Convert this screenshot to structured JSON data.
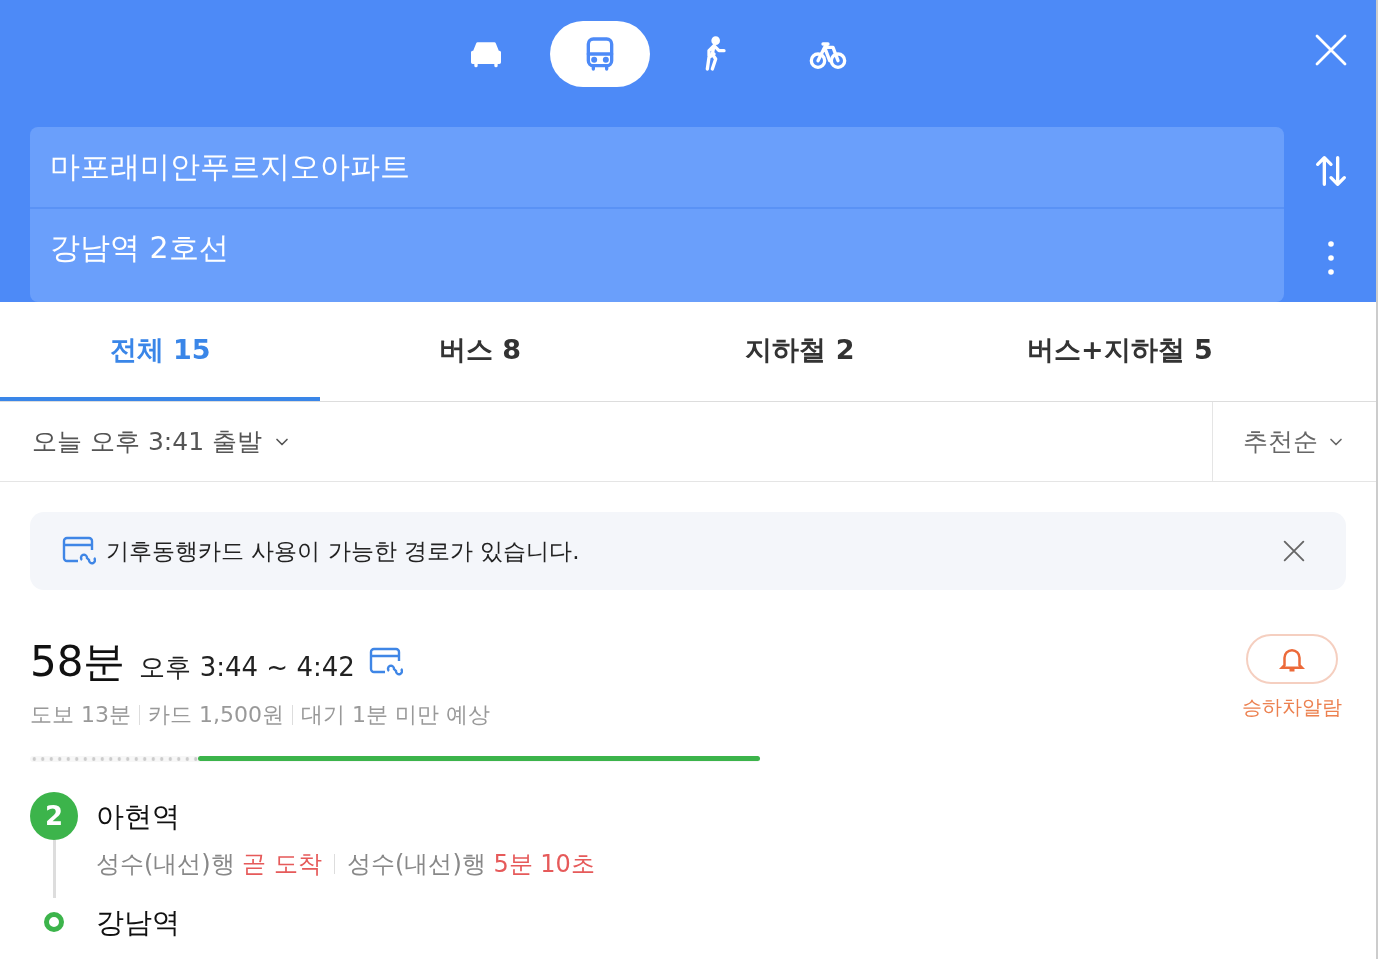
{
  "modes": [
    {
      "kind": "car",
      "selected": false
    },
    {
      "kind": "bus",
      "selected": true
    },
    {
      "kind": "walk",
      "selected": false
    },
    {
      "kind": "bike",
      "selected": false
    }
  ],
  "origin": {
    "value": "마포래미안푸르지오아파트"
  },
  "destination": {
    "value": "강남역 2호선"
  },
  "tabs": [
    {
      "label": "전체 15",
      "selected": true
    },
    {
      "label": "버스 8",
      "selected": false
    },
    {
      "label": "지하철 2",
      "selected": false
    },
    {
      "label": "버스+지하철 5",
      "selected": false
    }
  ],
  "departure": "오늘 오후 3:41 출발",
  "sort": "추천순",
  "banner": {
    "text": "기후동행카드 사용이 가능한 경로가 있습니다."
  },
  "route": {
    "duration": "58분",
    "time_range": "오후 3:44 ~ 4:42",
    "details": [
      "도보 13분",
      "카드 1,500원",
      "대기 1분 미만 예상"
    ],
    "alarm_label": "승하차알람",
    "segments": [
      {
        "kind": "walk",
        "level": 0.23
      },
      {
        "kind": "subway",
        "level": 0.77,
        "color": "#3cb44b"
      }
    ],
    "stops": [
      {
        "kind": "line",
        "badge": "2",
        "name": "아현역",
        "color": "#3cb44b",
        "arrivals": [
          {
            "direction": "성수(내선)행",
            "eta": "곧 도착"
          },
          {
            "direction": "성수(내선)행",
            "eta": "5분 10초"
          }
        ]
      },
      {
        "kind": "end",
        "name": "강남역",
        "color": "#3cb44b"
      }
    ]
  }
}
